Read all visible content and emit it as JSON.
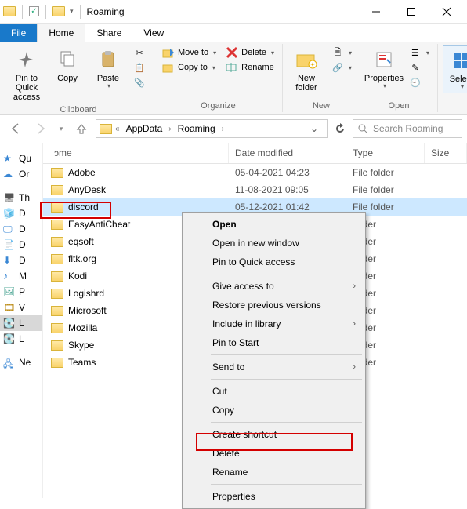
{
  "window": {
    "title": "Roaming"
  },
  "tabs": {
    "file": "File",
    "home": "Home",
    "share": "Share",
    "view": "View"
  },
  "ribbon": {
    "clipboard": {
      "label": "Clipboard",
      "pin": "Pin to Quick access",
      "copy": "Copy",
      "paste": "Paste"
    },
    "organize": {
      "label": "Organize",
      "move": "Move to",
      "copy": "Copy to",
      "delete": "Delete",
      "rename": "Rename"
    },
    "new": {
      "label": "New",
      "newfolder": "New folder"
    },
    "open": {
      "label": "Open",
      "properties": "Properties"
    },
    "select": {
      "label": "",
      "select": "Select"
    }
  },
  "breadcrumb": {
    "a": "AppData",
    "b": "Roaming"
  },
  "search": {
    "placeholder": "Search Roaming"
  },
  "columns": {
    "name": "ɔme",
    "date": "Date modified",
    "type": "Type",
    "size": "Size"
  },
  "folders": [
    {
      "name": "Adobe",
      "date": "05-04-2021 04:23",
      "type": "File folder"
    },
    {
      "name": "AnyDesk",
      "date": "11-08-2021 09:05",
      "type": "File folder"
    },
    {
      "name": "discord",
      "date": "05-12-2021 01:42",
      "type": "File folder",
      "selected": true
    },
    {
      "name": "EasyAntiCheat",
      "date": "",
      "type": "folder"
    },
    {
      "name": "eqsoft",
      "date": "",
      "type": "folder"
    },
    {
      "name": "fltk.org",
      "date": "",
      "type": "folder"
    },
    {
      "name": "Kodi",
      "date": "",
      "type": "folder"
    },
    {
      "name": "Logishrd",
      "date": "",
      "type": "folder"
    },
    {
      "name": "Microsoft",
      "date": "",
      "type": "folder"
    },
    {
      "name": "Mozilla",
      "date": "",
      "type": "folder"
    },
    {
      "name": "Skype",
      "date": "",
      "type": "folder"
    },
    {
      "name": "Teams",
      "date": "",
      "type": "folder"
    }
  ],
  "nav": {
    "items": [
      "Qu",
      "Or",
      "Th",
      "D",
      "D",
      "D",
      "D",
      "M",
      "P",
      "V",
      "L",
      "L",
      "Ne"
    ]
  },
  "context": {
    "open": "Open",
    "opennew": "Open in new window",
    "pinqa": "Pin to Quick access",
    "giveaccess": "Give access to",
    "restore": "Restore previous versions",
    "include": "Include in library",
    "pinstart": "Pin to Start",
    "sendto": "Send to",
    "cut": "Cut",
    "copy": "Copy",
    "shortcut": "Create shortcut",
    "delete": "Delete",
    "rename": "Rename",
    "properties": "Properties"
  }
}
